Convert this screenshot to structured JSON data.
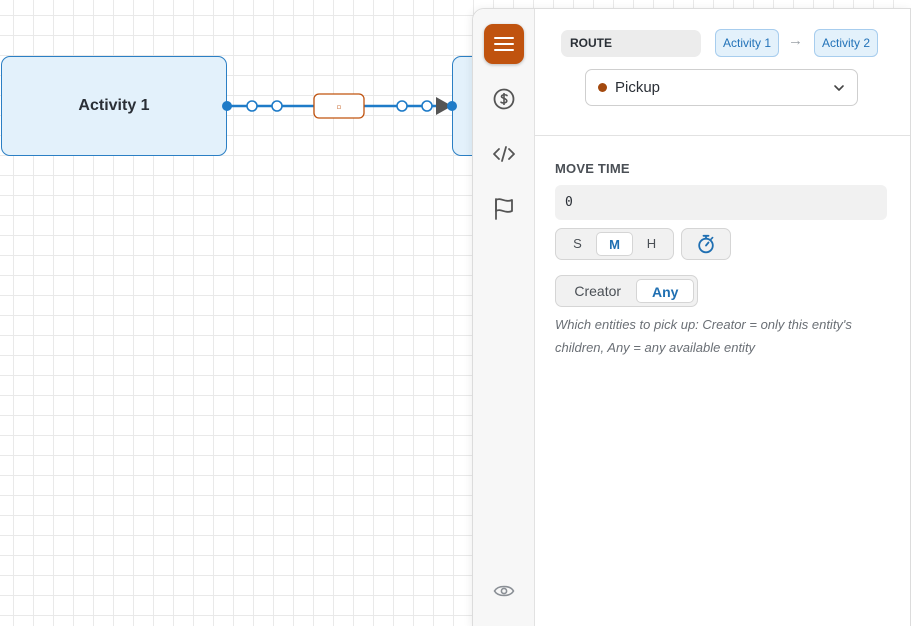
{
  "canvas": {
    "node1_label": "Activity 1",
    "connector_label": "▫"
  },
  "rail": {
    "items": [
      {
        "icon": "list-icon",
        "active": true
      },
      {
        "icon": "dollar-icon",
        "active": false
      },
      {
        "icon": "code-icon",
        "active": false
      },
      {
        "icon": "flag-icon",
        "active": false
      },
      {
        "icon": "eye-icon",
        "active": false
      }
    ]
  },
  "route": {
    "label": "ROUTE",
    "from": "Activity 1",
    "to": "Activity 2",
    "arrow": "→",
    "type_value": "Pickup"
  },
  "move_time": {
    "title": "MOVE TIME",
    "value": "0",
    "units": [
      "S",
      "M",
      "H"
    ],
    "selected_unit": "M"
  },
  "scope": {
    "options": [
      "Creator",
      "Any"
    ],
    "selected": "Any",
    "hint": "Which entities to pick up: Creator = only this entity's children, Any = any available entity"
  },
  "colors": {
    "accent": "#c0530f",
    "node_fill": "#e3f1fb",
    "link_blue": "#1e7bc8",
    "active_text": "#1f6fb2"
  }
}
